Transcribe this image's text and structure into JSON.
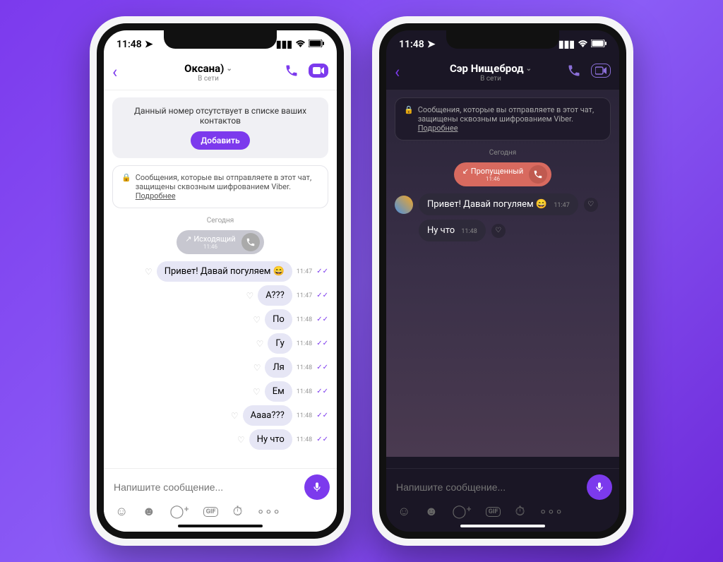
{
  "left": {
    "time": "11:48",
    "contact_name": "Оксана)",
    "contact_status": "В сети",
    "notice_text": "Данный номер отсутствует в списке ваших контактов",
    "add_label": "Добавить",
    "encryption_text": "Сообщения, которые вы отправляете в этот чат, защищены сквозным шифрованием Viber.",
    "encryption_more": "Подробнее",
    "date_label": "Сегодня",
    "call_label": "Исходящий",
    "call_time": "11:46",
    "messages": [
      {
        "text": "Привет! Давай погуляем 😄",
        "time": "11:47"
      },
      {
        "text": "А???",
        "time": "11:47"
      },
      {
        "text": "По",
        "time": "11:48"
      },
      {
        "text": "Гу",
        "time": "11:48"
      },
      {
        "text": "Ля",
        "time": "11:48"
      },
      {
        "text": "Ем",
        "time": "11:48"
      },
      {
        "text": "Аааа???",
        "time": "11:48"
      },
      {
        "text": "Ну что",
        "time": "11:48"
      }
    ],
    "input_placeholder": "Напишите сообщение..."
  },
  "right": {
    "time": "11:48",
    "contact_name": "Сэр Нищеброд",
    "contact_status": "В сети",
    "encryption_text": "Сообщения, которые вы отправляете в этот чат, защищены сквозным шифрованием Viber.",
    "encryption_more": "Подробнее",
    "date_label": "Сегодня",
    "call_label": "Пропущенный",
    "call_time": "11:46",
    "messages": [
      {
        "text": "Привет! Давай погуляем 😄",
        "time": "11:47"
      },
      {
        "text": "Ну что",
        "time": "11:48"
      }
    ],
    "input_placeholder": "Напишите сообщение..."
  }
}
